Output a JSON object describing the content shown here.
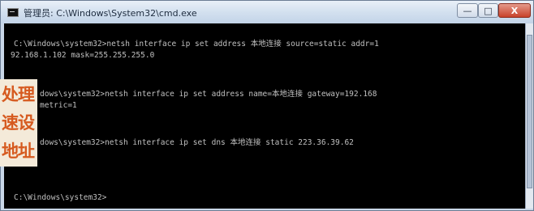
{
  "window": {
    "title": "管理员: C:\\Windows\\System32\\cmd.exe",
    "controls": {
      "minimize": "—",
      "maximize": "□",
      "close": "X"
    }
  },
  "console": {
    "lines": [
      "C:\\Windows\\system32>netsh interface ip set address 本地连接 source=static addr=1",
      "92.168.1.102 mask=255.255.255.0",
      "dows\\system32>netsh interface ip set address name=本地连接 gateway=192.168",
      "metric=1",
      "dows\\system32>netsh interface ip set dns 本地连接 static 223.36.39.62",
      "C:\\Windows\\system32>"
    ]
  },
  "overlay": {
    "lines": [
      "处理",
      "速设",
      "地址"
    ],
    "color": "#d65a1f"
  }
}
